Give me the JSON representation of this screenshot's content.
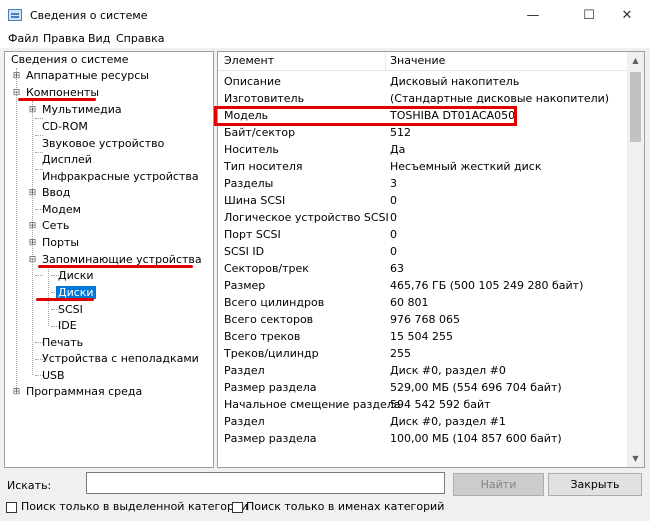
{
  "window": {
    "title": "Сведения о системе",
    "controls": {
      "minimize": "—",
      "maximize": "☐",
      "close": "✕"
    }
  },
  "menu": [
    "Файл",
    "Правка",
    "Вид",
    "Справка"
  ],
  "tree": {
    "root": "Сведения о системе",
    "hardware": "Аппаратные ресурсы",
    "components": "Компоненты",
    "multimedia": "Мультимедиа",
    "cdrom": "CD-ROM",
    "sound": "Звуковое устройство",
    "display": "Дисплей",
    "infrared": "Инфракрасные устройства",
    "input": "Ввод",
    "modem": "Модем",
    "network": "Сеть",
    "ports": "Порты",
    "storage": "Запоминающие устройства",
    "drives": "Диски",
    "disks": "Диски",
    "scsi": "SCSI",
    "ide": "IDE",
    "printing": "Печать",
    "problem_devices": "Устройства с неполадками",
    "usb": "USB",
    "software": "Программная среда"
  },
  "table": {
    "col_element": "Элемент",
    "col_value": "Значение",
    "rows": [
      [
        "Описание",
        "Дисковый накопитель"
      ],
      [
        "Изготовитель",
        "(Стандартные дисковые накопители)"
      ],
      [
        "Модель",
        "TOSHIBA DT01ACA050"
      ],
      [
        "Байт/сектор",
        "512"
      ],
      [
        "Носитель",
        "Да"
      ],
      [
        "Тип носителя",
        "Несъемный жесткий диск"
      ],
      [
        "Разделы",
        "3"
      ],
      [
        "Шина SCSI",
        "0"
      ],
      [
        "Логическое устройство SCSI",
        "0"
      ],
      [
        "Порт SCSI",
        "0"
      ],
      [
        "SCSI ID",
        "0"
      ],
      [
        "Секторов/трек",
        "63"
      ],
      [
        "Размер",
        "465,76 ГБ (500 105 249 280 байт)"
      ],
      [
        "Всего цилиндров",
        "60 801"
      ],
      [
        "Всего секторов",
        "976 768 065"
      ],
      [
        "Всего треков",
        "15 504 255"
      ],
      [
        "Треков/цилиндр",
        "255"
      ],
      [
        "Раздел",
        "Диск #0, раздел #0"
      ],
      [
        "Размер раздела",
        "529,00 МБ (554 696 704 байт)"
      ],
      [
        "Начальное смещение раздела",
        "594 542 592 байт"
      ],
      [
        "Раздел",
        "Диск #0, раздел #1"
      ],
      [
        "Размер раздела",
        "100,00 МБ (104 857 600 байт)"
      ]
    ]
  },
  "search": {
    "label": "Искать:",
    "value": "",
    "find_button": "Найти",
    "close_button": "Закрыть",
    "opt_selected_category": "Поиск только в выделенной категории",
    "opt_category_names": "Поиск только в именах категорий"
  },
  "colors": {
    "highlight": "#e00000",
    "selection": "#0078d7"
  }
}
